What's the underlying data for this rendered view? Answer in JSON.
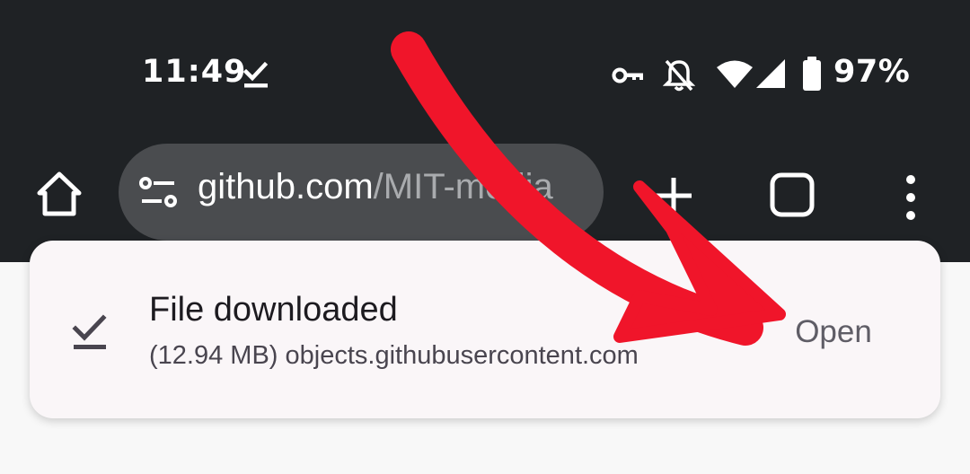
{
  "status_bar": {
    "time": "11:49",
    "battery_percent": "97%",
    "icons": [
      "download-done-icon",
      "key-icon",
      "notifications-off-icon",
      "wifi-icon",
      "cell-signal-icon",
      "battery-icon"
    ]
  },
  "toolbar": {
    "url_domain": "github.com",
    "url_path": "/MIT-media",
    "icons": [
      "home-icon",
      "tune-icon",
      "plus-icon",
      "tab-switcher-icon",
      "more-vert-icon"
    ]
  },
  "snackbar": {
    "title": "File downloaded",
    "subtitle": "(12.94 MB) objects.githubusercontent.com",
    "action_label": "Open",
    "icon": "download-done-icon"
  },
  "colors": {
    "topbar_bg": "#1f2225",
    "url_bar_bg": "#4a4c4f",
    "snackbar_bg": "#faf6f8",
    "annotation_arrow": "#f0152a"
  }
}
